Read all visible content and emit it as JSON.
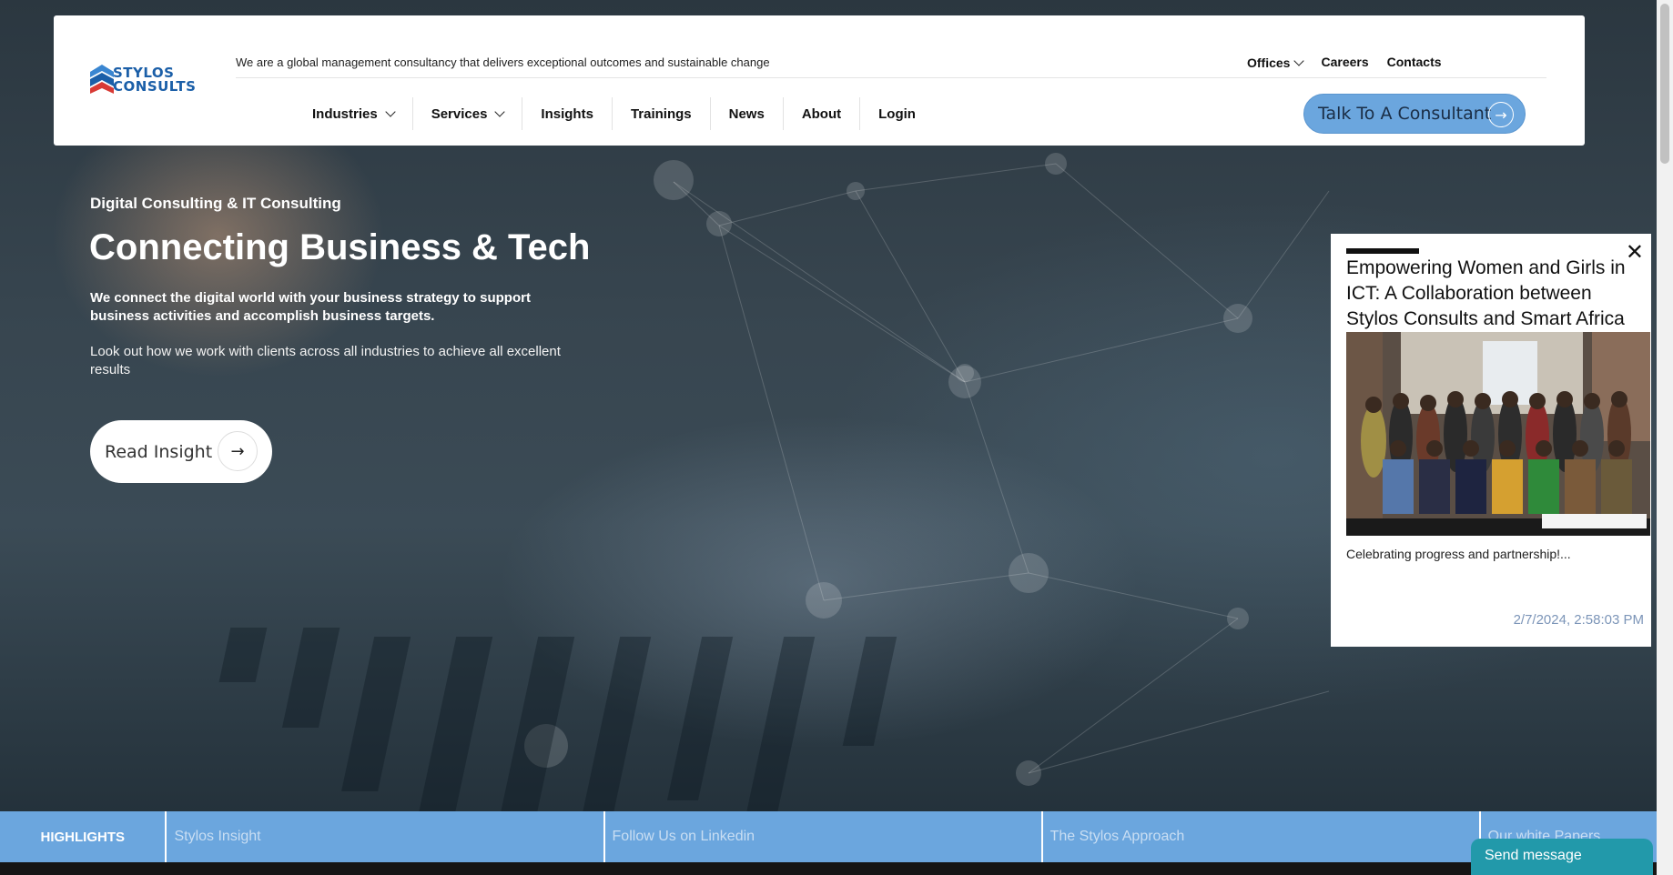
{
  "brand": {
    "logo_line1": "STYLOS",
    "logo_line2": "CONSULTS",
    "tagline": "We are a global management consultancy that delivers exceptional outcomes and sustainable change"
  },
  "top_links": {
    "offices": "Offices",
    "careers": "Careers",
    "contacts": "Contacts"
  },
  "nav": [
    {
      "label": "Industries",
      "dropdown": true
    },
    {
      "label": "Services",
      "dropdown": true
    },
    {
      "label": "Insights",
      "dropdown": false
    },
    {
      "label": "Trainings",
      "dropdown": false
    },
    {
      "label": "News",
      "dropdown": false
    },
    {
      "label": "About",
      "dropdown": false
    },
    {
      "label": "Login",
      "dropdown": false
    }
  ],
  "cta": {
    "label": "Talk To A Consultant",
    "icon": "arrow-right-icon"
  },
  "hero": {
    "eyebrow": "Digital Consulting & IT Consulting",
    "title": "Connecting Business & Tech",
    "lead": "We connect the digital world with your business strategy to support business activities and accomplish business targets.",
    "sub": "Look out how we work with clients across all industries to achieve all excellent results",
    "button": "Read Insight"
  },
  "popup": {
    "title": "Empowering Women and Girls in ICT: A Collaboration between Stylos Consults and Smart Africa",
    "caption": "Celebrating progress and partnership!...",
    "date": "2/7/2024, 2:58:03 PM",
    "close": "✕"
  },
  "highlights": {
    "label": "HIGHLIGHTS",
    "items": [
      "Stylos Insight",
      "Follow Us on Linkedin",
      "The Stylos Approach",
      "Our white Papers"
    ]
  },
  "chat": {
    "label": "Send message"
  },
  "colors": {
    "accent": "#6ba6de",
    "chat": "#2299aa"
  }
}
